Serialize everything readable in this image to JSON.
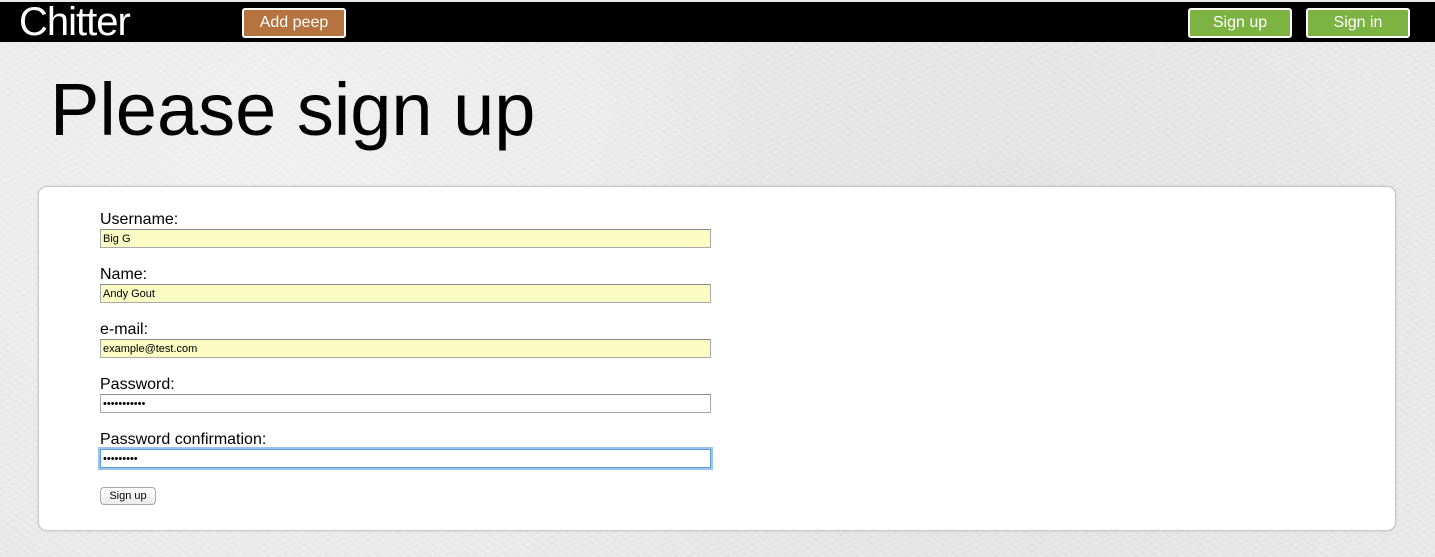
{
  "header": {
    "logo": "Chitter",
    "add_peep_label": "Add peep",
    "sign_up_label": "Sign up",
    "sign_in_label": "Sign in",
    "colors": {
      "bar": "#000000",
      "add_peep": "#b6733f",
      "auth_buttons": "#7cb342"
    }
  },
  "page": {
    "title": "Please sign up"
  },
  "form": {
    "username": {
      "label": "Username:",
      "value": "Big G"
    },
    "name": {
      "label": "Name:",
      "value": "Andy Gout"
    },
    "email": {
      "label": "e-mail:",
      "value": "example@test.com"
    },
    "password": {
      "label": "Password:",
      "value": "•••••••••••"
    },
    "password_confirmation": {
      "label": "Password confirmation:",
      "value": "•••••••••"
    },
    "submit_label": "Sign up",
    "autofill_color": "#fafcc3"
  }
}
